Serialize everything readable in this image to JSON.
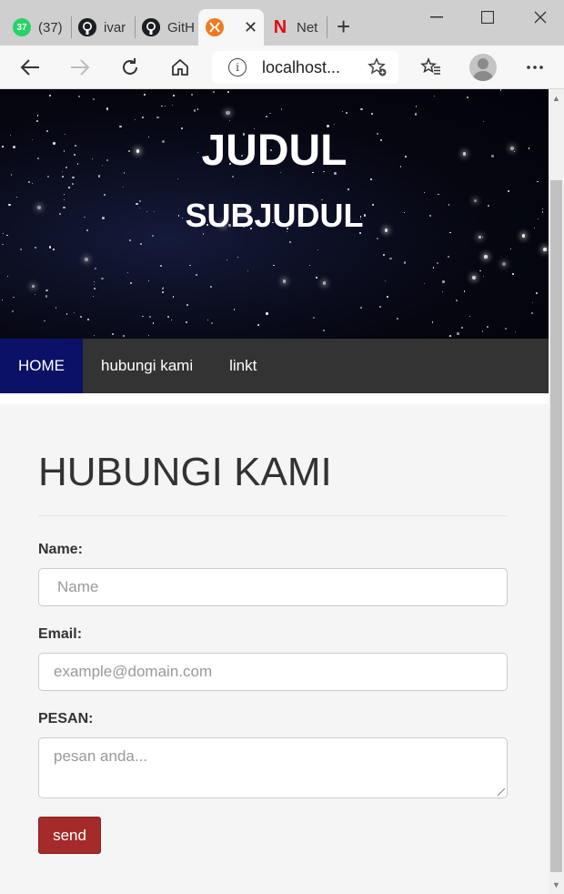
{
  "browser": {
    "tabs": [
      {
        "label": "(37)",
        "icon": "whatsapp-icon",
        "badge": "37"
      },
      {
        "label": "ivar",
        "icon": "github-icon"
      },
      {
        "label": "GitH",
        "icon": "github-icon"
      },
      {
        "label": "",
        "icon": "xampp-icon",
        "active": true
      },
      {
        "label": "Net",
        "icon": "netflix-icon",
        "letter": "N"
      }
    ],
    "new_tab": "+",
    "address": "localhost...",
    "info_glyph": "i"
  },
  "page": {
    "hero": {
      "title": "JUDUL",
      "subtitle": "SUBJUDUL"
    },
    "nav": [
      {
        "label": "HOME",
        "active": true
      },
      {
        "label": "hubungi kami",
        "active": false
      },
      {
        "label": "linkt",
        "active": false
      }
    ],
    "heading": "HUBUNGI KAMI",
    "form": {
      "name_label": "Name:",
      "name_placeholder": "Name",
      "email_label": "Email:",
      "email_placeholder": "example@domain.com",
      "message_label": "PESAN:",
      "message_placeholder": "pesan anda...",
      "submit_label": "send"
    }
  },
  "colors": {
    "nav_active": "#0a1166",
    "nav_bg": "#333333",
    "button": "#a52a2a",
    "page_bg": "#f6f5f5"
  }
}
